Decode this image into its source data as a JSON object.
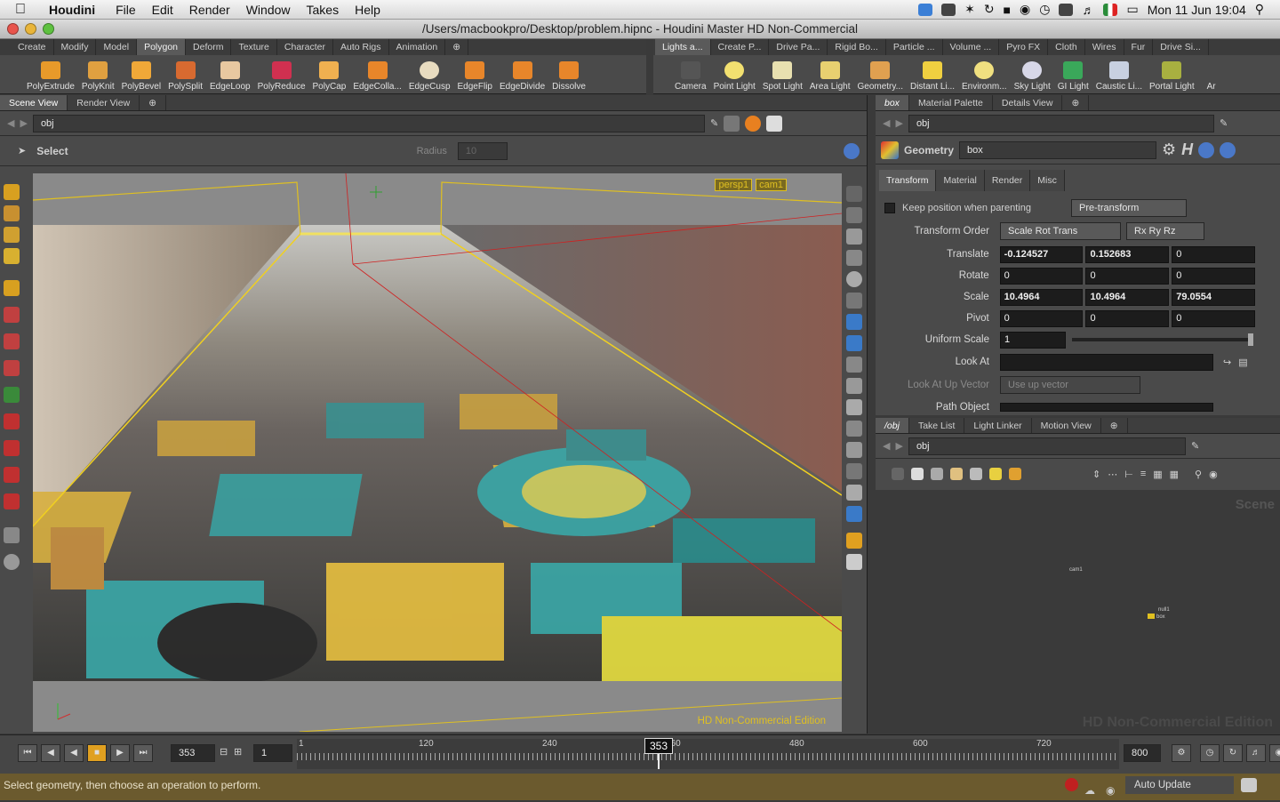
{
  "menubar": {
    "app": "Houdini",
    "items": [
      "File",
      "Edit",
      "Render",
      "Window",
      "Takes",
      "Help"
    ],
    "clock": "Mon 11 Jun  19:04"
  },
  "window": {
    "title": "/Users/macbookpro/Desktop/problem.hipnc - Houdini Master HD Non-Commercial"
  },
  "shelf_left": {
    "tabs": [
      "Create",
      "Modify",
      "Model",
      "Polygon",
      "Deform",
      "Texture",
      "Character",
      "Auto Rigs",
      "Animation"
    ],
    "active": "Polygon",
    "tools": [
      "PolyExtrude",
      "PolyKnit",
      "PolyBevel",
      "PolySplit",
      "EdgeLoop",
      "PolyReduce",
      "PolyCap",
      "EdgeColla...",
      "EdgeCusp",
      "EdgeFlip",
      "EdgeDivide",
      "Dissolve"
    ]
  },
  "shelf_right": {
    "tabs": [
      "Lights a...",
      "Create P...",
      "Drive Pa...",
      "Rigid Bo...",
      "Particle ...",
      "Volume ...",
      "Pyro FX",
      "Cloth",
      "Wires",
      "Fur",
      "Drive Si..."
    ],
    "tools": [
      "Camera",
      "Point Light",
      "Spot Light",
      "Area Light",
      "Geometry...",
      "Distant Li...",
      "Environm...",
      "Sky Light",
      "GI Light",
      "Caustic Li...",
      "Portal Light",
      "Ar"
    ]
  },
  "scene": {
    "tabs": [
      "Scene View",
      "Render View"
    ],
    "path": "obj",
    "mode": "Select",
    "radius_label": "Radius",
    "radius_value": "10",
    "cam_persp": "persp1",
    "cam_cam": "cam1",
    "watermark": "HD Non-Commercial Edition"
  },
  "params": {
    "tabs": [
      "box",
      "Material Palette",
      "Details View"
    ],
    "path": "obj",
    "node_type": "Geometry",
    "node_name": "box",
    "subtabs": [
      "Transform",
      "Material",
      "Render",
      "Misc"
    ],
    "keep_pos": "Keep position when parenting",
    "pretransform": "Pre-transform",
    "transform_order_label": "Transform Order",
    "transform_order": "Scale Rot Trans",
    "rot_order": "Rx Ry Rz",
    "translate_label": "Translate",
    "translate": [
      "-0.124527",
      "0.152683",
      "0"
    ],
    "rotate_label": "Rotate",
    "rotate": [
      "0",
      "0",
      "0"
    ],
    "scale_label": "Scale",
    "scale": [
      "10.4964",
      "10.4964",
      "79.0554"
    ],
    "pivot_label": "Pivot",
    "pivot": [
      "0",
      "0",
      "0"
    ],
    "uniform_label": "Uniform Scale",
    "uniform": "1",
    "lookat_label": "Look At",
    "upvec_label": "Look At Up Vector",
    "upvec": "Use up vector",
    "pathobj_label": "Path Object"
  },
  "network": {
    "tabs": [
      "/obj",
      "Take List",
      "Light Linker",
      "Motion View"
    ],
    "path": "obj",
    "nodes": [
      "cam1",
      "null1",
      "box"
    ],
    "scene_label": "Scene",
    "watermark": "HD Non-Commercial Edition"
  },
  "timeline": {
    "frame": "353",
    "step": "1",
    "ticks": [
      "1",
      "120",
      "240",
      "360",
      "480",
      "600",
      "720"
    ],
    "end": "800",
    "current": "353"
  },
  "status": {
    "message": "Select geometry, then choose an operation to perform.",
    "update": "Auto Update"
  }
}
